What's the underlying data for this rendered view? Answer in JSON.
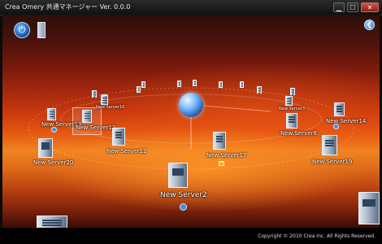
{
  "window": {
    "title": "Crea Omery 共通マネージャー Ver. 0.0.0"
  },
  "window_buttons": {
    "minimize": "▁",
    "maximize": "☐",
    "close": "✕"
  },
  "toolbar": {
    "power_icon": "power-icon",
    "document_icon": "document-icon",
    "back_icon": "back-arrow-icon",
    "power_glyph": "⏻",
    "back_glyph": "❮"
  },
  "center_node": {
    "icon": "globe-icon"
  },
  "servers": [
    {
      "id": "s1",
      "label": "New Server2"
    },
    {
      "id": "s2",
      "label": "New Server17"
    },
    {
      "id": "s3",
      "label": "New Server11"
    },
    {
      "id": "s4",
      "label": "New Server20"
    },
    {
      "id": "s5",
      "label": "New Server19"
    },
    {
      "id": "s6",
      "label": "New Server12"
    },
    {
      "id": "s7",
      "label": "New Server14"
    },
    {
      "id": "s8",
      "label": "New Server8"
    },
    {
      "id": "s9",
      "label": "New Server16"
    },
    {
      "id": "s10",
      "label": "New Server13"
    },
    {
      "id": "s11",
      "label": "New Server3"
    }
  ],
  "footer": {
    "copyright": "Copyright © 2010 Crea Inc. All Rights Reserved."
  }
}
